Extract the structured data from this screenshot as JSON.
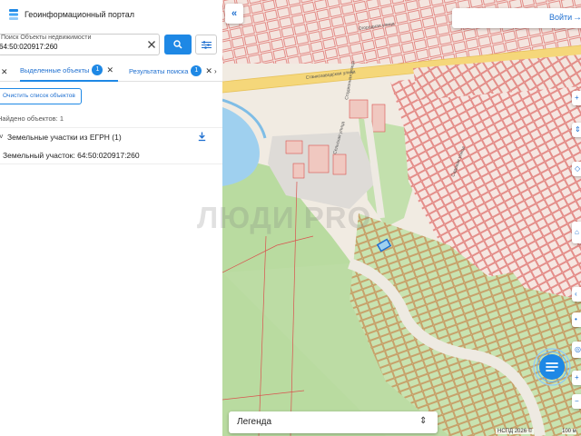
{
  "app": {
    "title": "Геоинформационный портал"
  },
  "search": {
    "label": "Поиск Объекты недвижимости",
    "value": "64:50:020917:260"
  },
  "tabs": [
    {
      "label": "Выделенные объекты",
      "badge": "1"
    },
    {
      "label": "Результаты поиска",
      "badge": "1"
    }
  ],
  "results": {
    "clear_list_label": "Очистить список объектов",
    "found_text": "Найдено объектов: 1",
    "group_label": "Земельные участки из ЕГРН (1)",
    "item_label": "Земельный участок: 64:50:020917:260"
  },
  "map": {
    "login_label": "Войти",
    "legend_label": "Легенда",
    "copyright": "НСПД 2026 ©",
    "scale": "100 м",
    "watermark": "ЛЮДИ PRO",
    "streets": [
      "Станкозаводская улица",
      "Стадионная улица",
      "Сельская улица",
      "Садовая улица",
      "Огородная улица"
    ]
  },
  "icons": {
    "logo": "layers-logo-icon",
    "clear": "close-icon",
    "search": "search-icon",
    "filter": "sliders-icon",
    "download": "download-icon",
    "collapse": "chevron-double-left-icon",
    "login": "login-icon",
    "chat": "chat-icon"
  },
  "colors": {
    "accent": "#1e88e5",
    "parcel_outline": "#d9534f",
    "road": "#f5d77a",
    "green": "#b9dba0",
    "water": "#9fd0ef"
  }
}
